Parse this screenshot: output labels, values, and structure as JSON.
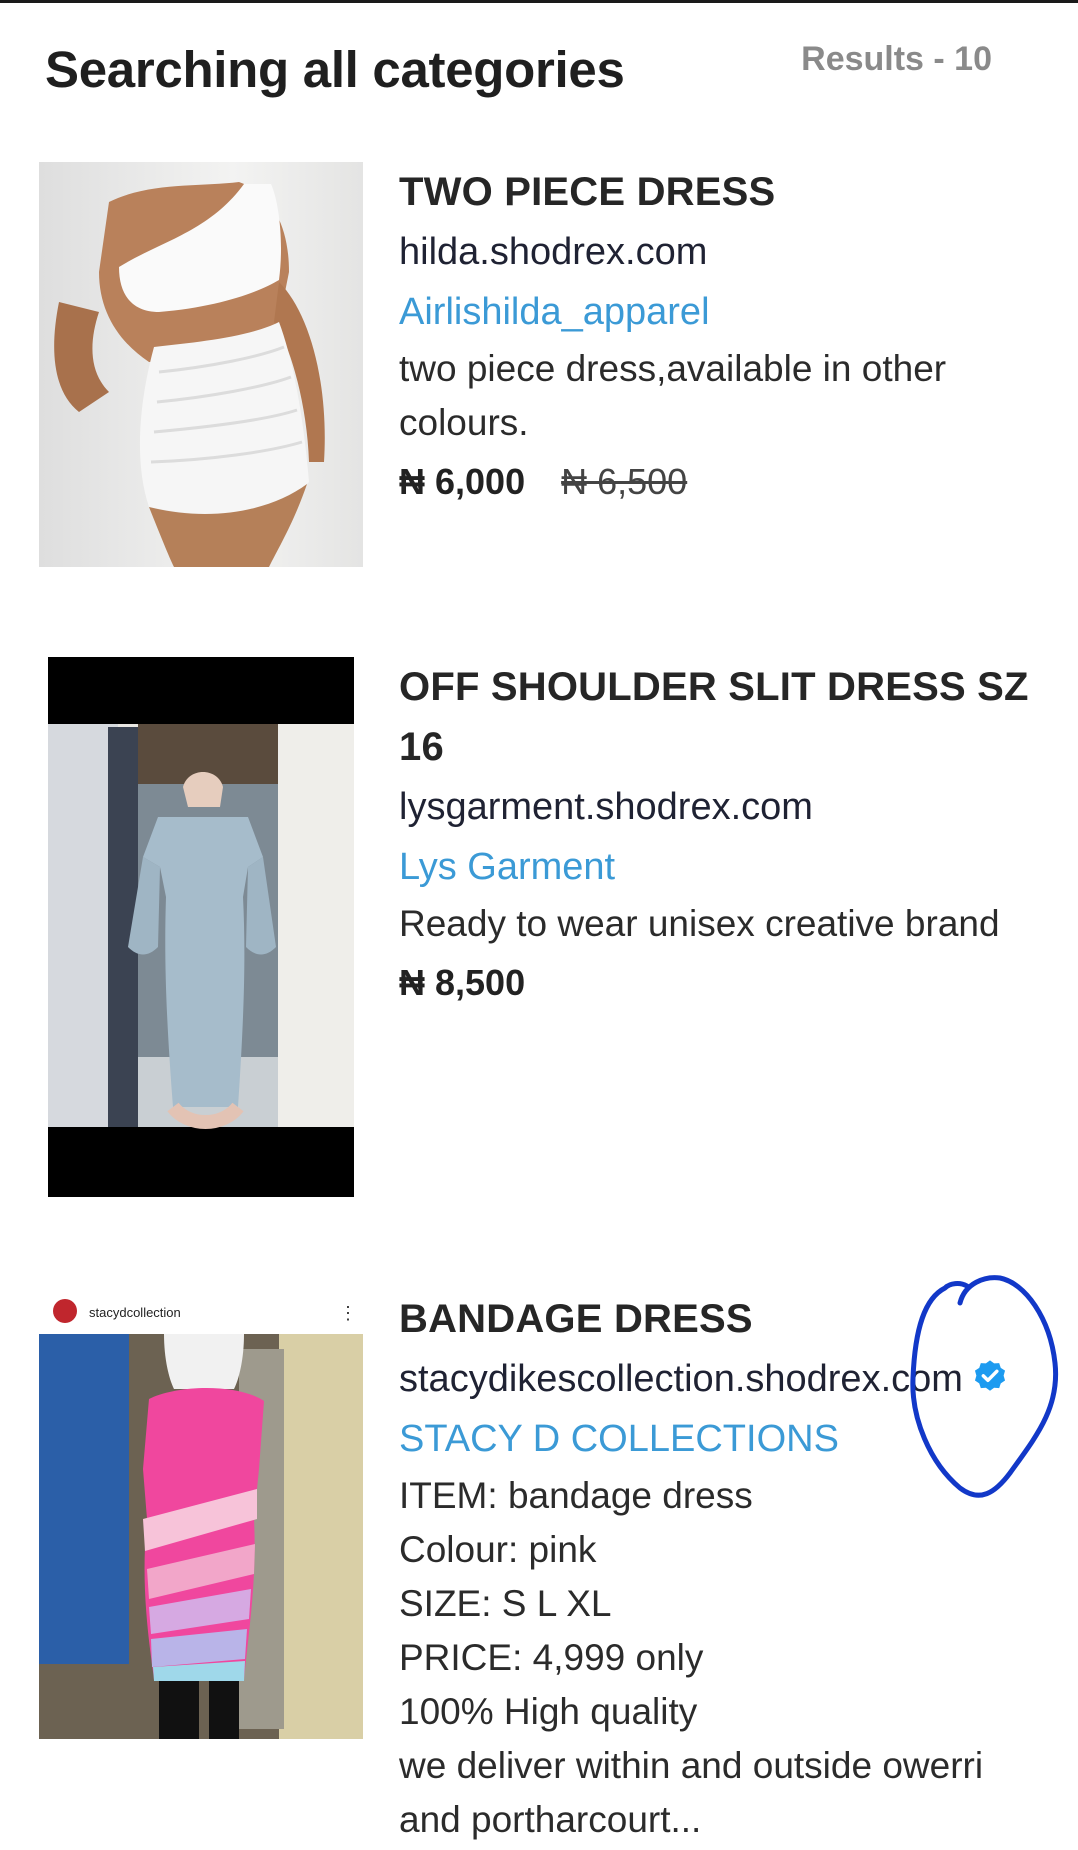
{
  "header": {
    "title": "Searching all categories",
    "results": "Results - 10"
  },
  "products": [
    {
      "title": "TWO PIECE DRESS",
      "domain": "hilda.shodrex.com",
      "shop": "Airlishilda_apparel",
      "description": [
        "two piece dress,available in other",
        "colours."
      ],
      "price": "₦ 6,000",
      "old_price": "₦ 6,500",
      "verified": false
    },
    {
      "title_lines": [
        "OFF SHOULDER SLIT DRESS SZ",
        "16"
      ],
      "domain": "lysgarment.shodrex.com",
      "shop": "Lys Garment",
      "description": [
        "Ready to wear unisex creative brand"
      ],
      "price": "₦ 8,500",
      "verified": false
    },
    {
      "title": "BANDAGE DRESS",
      "domain": "stacydikescollection.shodrex.com",
      "shop": "STACY D COLLECTIONS",
      "description": [
        "ITEM: bandage dress",
        "Colour: pink",
        "SIZE: S L XL",
        "PRICE: 4,999 only",
        "100% High quality",
        "we deliver within and outside owerri",
        "and portharcourt..."
      ],
      "verified": true,
      "image_username": "stacydcollection"
    }
  ],
  "colors": {
    "shop_link": "#3b9ad6",
    "verified_badge": "#1d9bf0",
    "annotation": "#1238c8"
  }
}
